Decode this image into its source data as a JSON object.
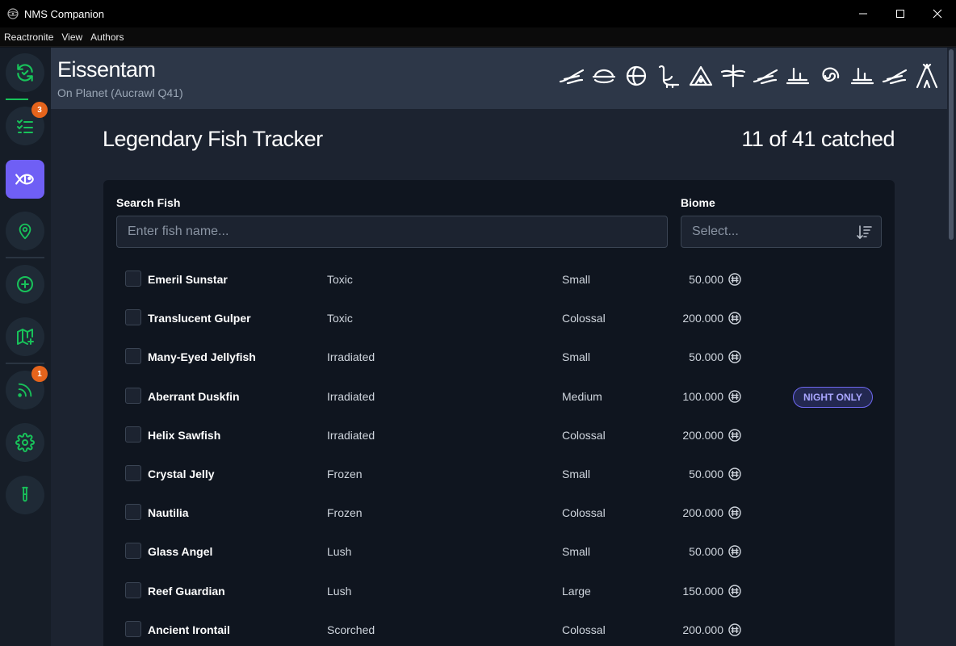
{
  "window": {
    "title": "NMS Companion"
  },
  "menu": [
    "Reactronite",
    "View",
    "Authors"
  ],
  "sidebar": {
    "badges": {
      "tasks": "3",
      "feed": "1"
    }
  },
  "header": {
    "planet": "Eissentam",
    "subtitle": "On Planet (Aucrawl Q41)",
    "glyph_count": 12
  },
  "page": {
    "title": "Legendary Fish Tracker",
    "count": "11 of 41 catched"
  },
  "filters": {
    "search_label": "Search Fish",
    "search_placeholder": "Enter fish name...",
    "biome_label": "Biome",
    "biome_placeholder": "Select..."
  },
  "fish": [
    {
      "name": "Emeril Sunstar",
      "biome": "Toxic",
      "size": "Small",
      "price": "50.000",
      "badge": ""
    },
    {
      "name": "Translucent Gulper",
      "biome": "Toxic",
      "size": "Colossal",
      "price": "200.000",
      "badge": ""
    },
    {
      "name": "Many-Eyed Jellyfish",
      "biome": "Irradiated",
      "size": "Small",
      "price": "50.000",
      "badge": ""
    },
    {
      "name": "Aberrant Duskfin",
      "biome": "Irradiated",
      "size": "Medium",
      "price": "100.000",
      "badge": "NIGHT ONLY"
    },
    {
      "name": "Helix Sawfish",
      "biome": "Irradiated",
      "size": "Colossal",
      "price": "200.000",
      "badge": ""
    },
    {
      "name": "Crystal Jelly",
      "biome": "Frozen",
      "size": "Small",
      "price": "50.000",
      "badge": ""
    },
    {
      "name": "Nautilia",
      "biome": "Frozen",
      "size": "Colossal",
      "price": "200.000",
      "badge": ""
    },
    {
      "name": "Glass Angel",
      "biome": "Lush",
      "size": "Small",
      "price": "50.000",
      "badge": ""
    },
    {
      "name": "Reef Guardian",
      "biome": "Lush",
      "size": "Large",
      "price": "150.000",
      "badge": ""
    },
    {
      "name": "Ancient Irontail",
      "biome": "Scorched",
      "size": "Colossal",
      "price": "200.000",
      "badge": ""
    }
  ],
  "colors": {
    "accent": "#6f5ff5",
    "green": "#18c25a",
    "badge_orange": "#e5641c"
  }
}
